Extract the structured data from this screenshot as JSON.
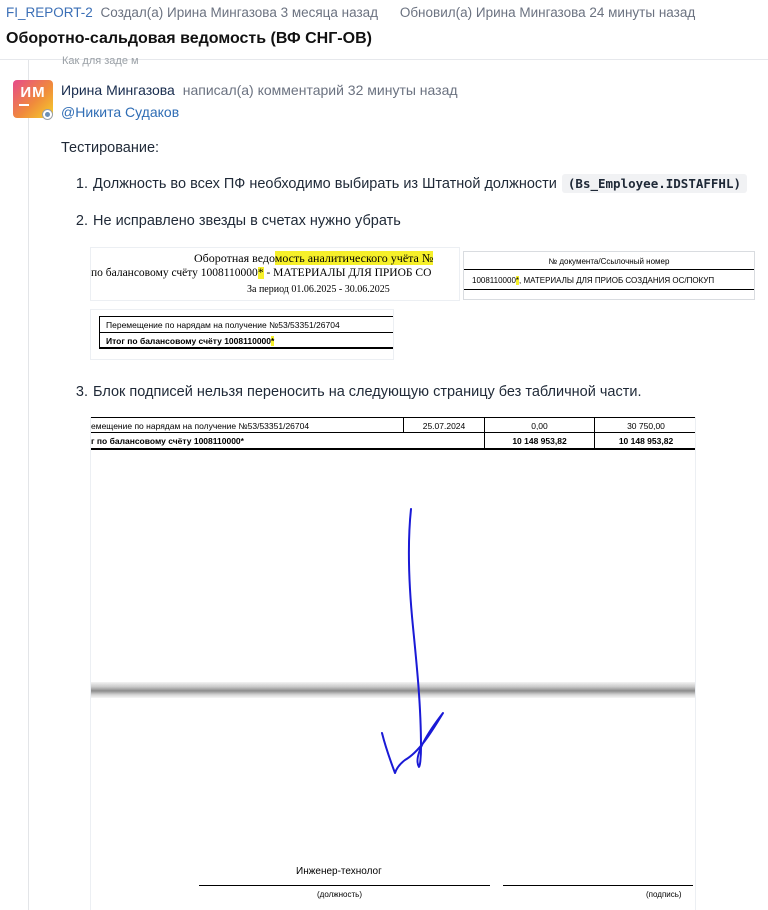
{
  "header": {
    "issue_key": "FI_REPORT-2",
    "created": "Создал(а) Ирина Мингазова 3 месяца назад",
    "updated": "Обновил(а) Ирина Мингазова 24 минуты назад",
    "title": "Оборотно-сальдовая ведомость (ВФ СНГ-ОВ)",
    "partial_line": "Как для заде м"
  },
  "comment": {
    "avatar_initials": "ИМ",
    "author": "Ирина Мингазова",
    "action": "написал(а) комментарий 32 минуты назад",
    "mention": "@Никита Судаков",
    "intro": "Тестирование:",
    "items": [
      {
        "num": "1.",
        "text": "Должность во всех ПФ необходимо выбирать из Штатной должности",
        "code": "(Bs_Employee.IDSTAFFHL)"
      },
      {
        "num": "2.",
        "text": "Не исправлено звезды в счетах нужно убрать"
      },
      {
        "num": "3.",
        "text": "Блок подписей нельзя переносить на следующую страницу без табличной части."
      }
    ]
  },
  "shot1": {
    "line1_a": "Оборотная ведо",
    "line1_b": "мость аналитического учёта №",
    "line2_a": "по балансовому счёту 1008110000",
    "line2_star": "*",
    "line2_b": " - МАТЕРИАЛЫ ДЛЯ ПРИОБ СО",
    "line3": "За период 01.06.2025 - 30.06.2025"
  },
  "shot2": {
    "header": "№ документа/Ссылочный номер",
    "row_a": "1008110000",
    "row_star": "*",
    "row_b": ", МАТЕРИАЛЫ ДЛЯ ПРИОБ СОЗДАНИЯ ОС/ПОКУП"
  },
  "shot3": {
    "row1_a": "Перемещение по нарядам на получение",
    "row1_b": " №53/53351/26704",
    "row2_a": "Итог по балансовому счёту 1008110000",
    "row2_star": "*"
  },
  "shot4": {
    "row1": [
      "емещение по нарядам на получение №53/53351/26704",
      "25.07.2024",
      "0,00",
      "30 750,00"
    ],
    "row2": [
      "г по балансовому счёту 1008110000*",
      "",
      "10 148 953,82",
      "10 148 953,82"
    ],
    "engineer": "Инженер-технолог",
    "caption_position": "(должность)",
    "caption_signature": "(подпись)"
  },
  "colors": {
    "link": "#2f6db5",
    "highlight": "#f6f02a",
    "annotation_arrow": "#1a1ad6"
  }
}
